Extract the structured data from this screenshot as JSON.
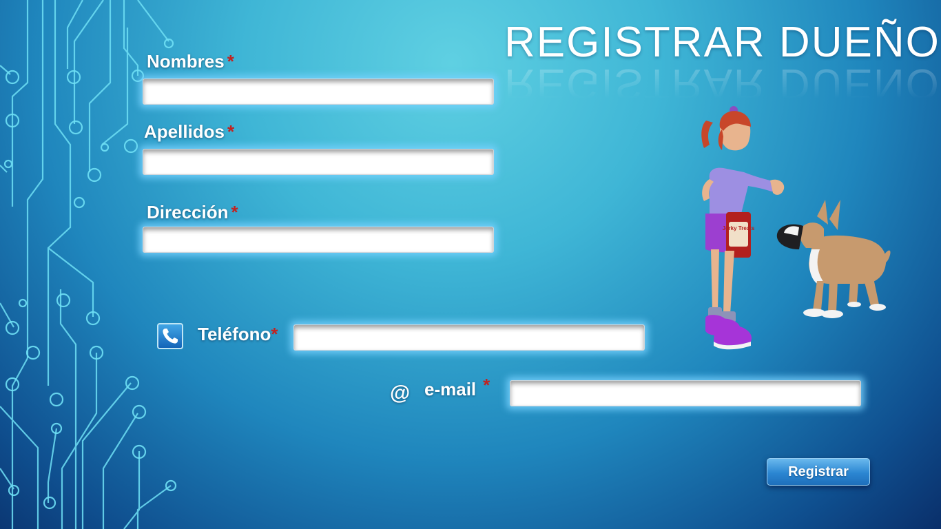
{
  "title": "REGISTRAR DUEÑO",
  "form": {
    "nombres": {
      "label": "Nombres",
      "required_mark": "*",
      "value": "",
      "placeholder": ""
    },
    "apellidos": {
      "label": "Apellidos",
      "required_mark": "*",
      "value": "",
      "placeholder": ""
    },
    "direccion": {
      "label": "Dirección",
      "required_mark": "*",
      "value": "",
      "placeholder": ""
    },
    "telefono": {
      "label": "Teléfono",
      "required_mark": "*",
      "value": "",
      "placeholder": "",
      "icon": "phone-icon"
    },
    "email": {
      "label": "e-mail",
      "required_mark": "*",
      "value": "",
      "placeholder": "",
      "icon_glyph": "@"
    }
  },
  "submit_label": "Registrar",
  "illustration": {
    "can_text": "Jerky Treats"
  },
  "colors": {
    "background_light": "#5fd0e2",
    "background_dark": "#0a2f6a",
    "required_mark": "#c2221f",
    "button": "#2b86d2",
    "field_glow": "#78d2ff",
    "circuit_lines": "#6fe0f5"
  }
}
